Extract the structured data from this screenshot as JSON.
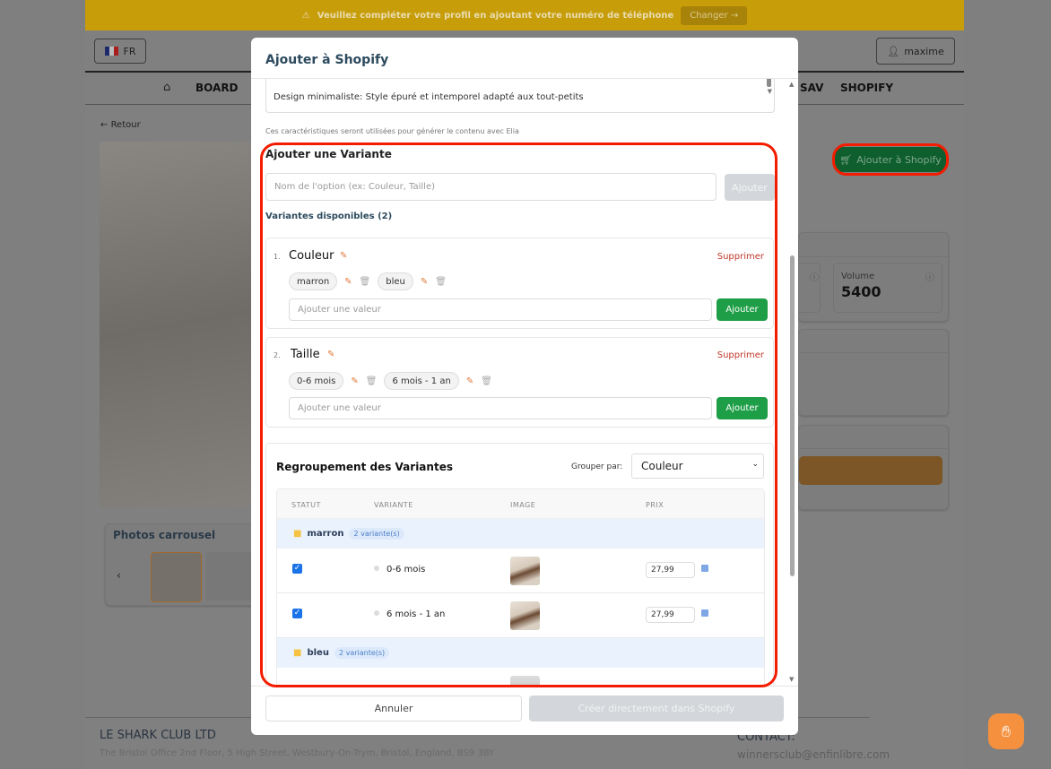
{
  "banner": {
    "text": "Veuillez compléter votre profil en ajoutant votre numéro de téléphone",
    "button": "Changer"
  },
  "header": {
    "lang": "FR",
    "user": "maxime"
  },
  "nav": {
    "items": [
      "BOARD",
      "SAV",
      "SHOPIFY"
    ]
  },
  "page": {
    "back": "Retour",
    "add_shopify": "Ajouter à Shopify",
    "volume_label": "Volume",
    "volume_value": "5400",
    "carousel_title": "Photos carrousel"
  },
  "footer": {
    "company": "LE SHARK CLUB LTD",
    "address": "The Bristol Office 2nd Floor, 5 High Street, Westbury-On-Trym, Bristol, England, BS9 3BY",
    "contact_label": "CONTACT:",
    "email": "winnersclub@enfinlibre.com"
  },
  "modal": {
    "title": "Ajouter à Shopify",
    "textarea_text": "Design minimaliste: Style épuré et intemporel adapté aux tout-petits",
    "hint": "Ces caractéristiques seront utilisées pour générer le contenu avec Elia",
    "variant_title": "Ajouter une Variante",
    "option_placeholder": "Nom de l'option (ex: Couleur, Taille)",
    "add_label": "Ajouter",
    "available": "Variantes disponibles (2)",
    "delete_label": "Supprimer",
    "value_placeholder": "Ajouter une valeur",
    "options": [
      {
        "num": "1.",
        "name": "Couleur",
        "values": [
          "marron",
          "bleu"
        ]
      },
      {
        "num": "2.",
        "name": "Taille",
        "values": [
          "0-6 mois",
          "6 mois - 1 an"
        ]
      }
    ],
    "grouping": {
      "title": "Regroupement des Variantes",
      "group_by_label": "Grouper par:",
      "group_by_value": "Couleur",
      "columns": [
        "STATUT",
        "VARIANTE",
        "IMAGE",
        "PRIX"
      ],
      "groups": [
        {
          "name": "marron",
          "badge": "2 variante(s)",
          "rows": [
            {
              "checked": true,
              "variant": "0-6 mois",
              "price": "27,99"
            },
            {
              "checked": true,
              "variant": "6 mois - 1 an",
              "price": "27,99"
            }
          ]
        },
        {
          "name": "bleu",
          "badge": "2 variante(s)"
        }
      ]
    },
    "cancel": "Annuler",
    "create": "Créer directement dans Shopify"
  },
  "colors": {
    "annotation": "#f41c00",
    "green": "#1e9e47",
    "accent": "#2c4a5e"
  }
}
